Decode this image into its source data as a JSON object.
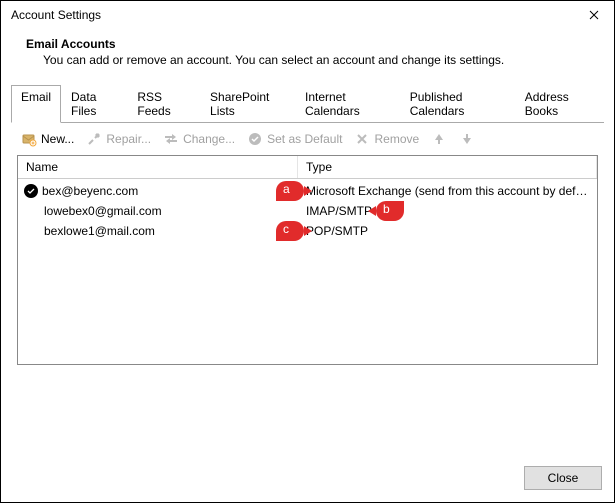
{
  "window": {
    "title": "Account Settings"
  },
  "header": {
    "title": "Email Accounts",
    "subtitle": "You can add or remove an account. You can select an account and change its settings."
  },
  "tabs": {
    "items": [
      {
        "label": "Email"
      },
      {
        "label": "Data Files"
      },
      {
        "label": "RSS Feeds"
      },
      {
        "label": "SharePoint Lists"
      },
      {
        "label": "Internet Calendars"
      },
      {
        "label": "Published Calendars"
      },
      {
        "label": "Address Books"
      }
    ],
    "active_index": 0
  },
  "toolbar": {
    "new": "New...",
    "repair": "Repair...",
    "change": "Change...",
    "set_default": "Set as Default",
    "remove": "Remove"
  },
  "list": {
    "columns": {
      "name": "Name",
      "type": "Type"
    },
    "rows": [
      {
        "name": "bex@beyenc.com",
        "type": "Microsoft Exchange (send from this account by def…",
        "default": true
      },
      {
        "name": "lowebex0@gmail.com",
        "type": "IMAP/SMTP",
        "default": false
      },
      {
        "name": "bexlowe1@mail.com",
        "type": "POP/SMTP",
        "default": false
      }
    ]
  },
  "callouts": {
    "a": "a",
    "b": "b",
    "c": "c"
  },
  "footer": {
    "close": "Close"
  }
}
